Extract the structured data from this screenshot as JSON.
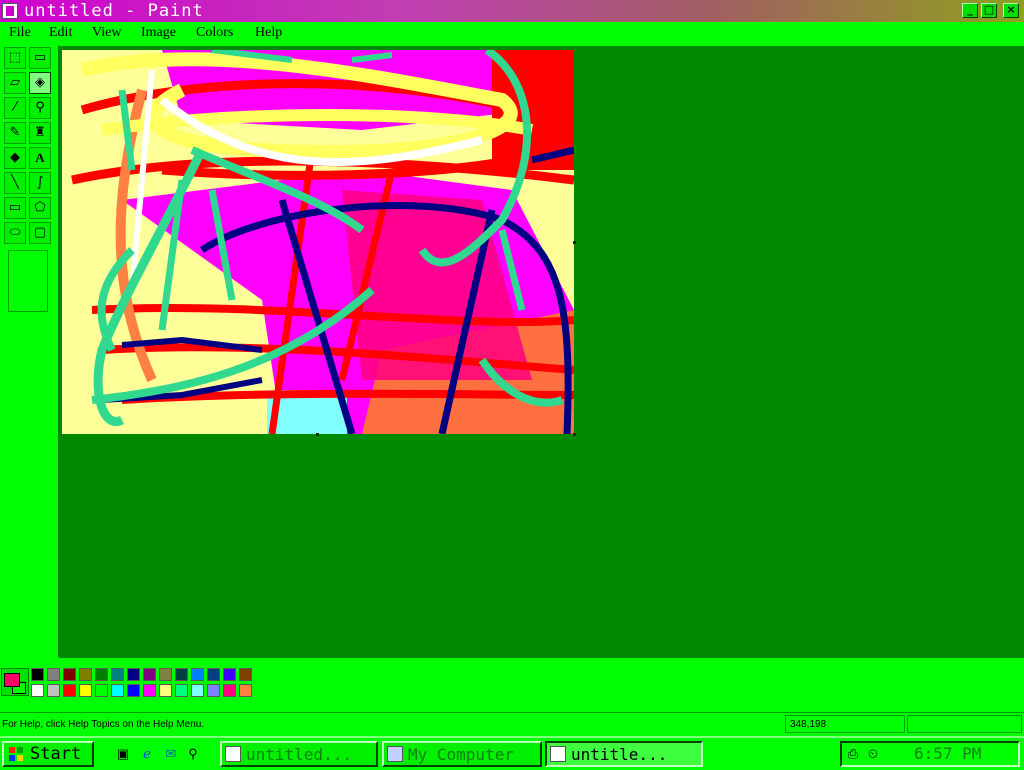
{
  "window": {
    "title": "untitled - Paint",
    "controls": [
      "_",
      "□",
      "×"
    ]
  },
  "menu": [
    "File",
    "Edit",
    "View",
    "Image",
    "Colors",
    "Help"
  ],
  "tools": [
    {
      "name": "free-form-select",
      "glyph": "⬚"
    },
    {
      "name": "select",
      "glyph": "▭"
    },
    {
      "name": "eraser",
      "glyph": "▱"
    },
    {
      "name": "fill-with-color",
      "glyph": "◈"
    },
    {
      "name": "pick-color",
      "glyph": "⁄"
    },
    {
      "name": "magnifier",
      "glyph": "⚲"
    },
    {
      "name": "pencil",
      "glyph": "✎"
    },
    {
      "name": "brush",
      "glyph": "♜"
    },
    {
      "name": "airbrush",
      "glyph": "◆"
    },
    {
      "name": "text",
      "glyph": "A"
    },
    {
      "name": "line",
      "glyph": "╲"
    },
    {
      "name": "curve",
      "glyph": "∫"
    },
    {
      "name": "rectangle",
      "glyph": "▭"
    },
    {
      "name": "polygon",
      "glyph": "⬠"
    },
    {
      "name": "ellipse",
      "glyph": "⬭"
    },
    {
      "name": "rounded-rectangle",
      "glyph": "▢"
    }
  ],
  "active_tool": "fill-with-color",
  "colors": {
    "foreground": "#ff0066",
    "background": "#00ff00",
    "palette_row1": [
      "#000000",
      "#808080",
      "#800000",
      "#808000",
      "#008000",
      "#008080",
      "#000080",
      "#800080",
      "#808040",
      "#004040",
      "#0080ff",
      "#004080",
      "#4000ff",
      "#804000"
    ],
    "palette_row2": [
      "#ffffff",
      "#c0c0c0",
      "#ff0000",
      "#ffff00",
      "#00ff00",
      "#00ffff",
      "#0000ff",
      "#ff00ff",
      "#ffff80",
      "#00ff80",
      "#80ffff",
      "#8080ff",
      "#ff0080",
      "#ff8040"
    ]
  },
  "status": {
    "help": "For Help, click Help Topics on the Help Menu.",
    "coords": "348,198"
  },
  "taskbar": {
    "start": "Start",
    "quick_launch": [
      "desktop-icon",
      "internet-explorer-icon",
      "outlook-express-icon",
      "channels-icon"
    ],
    "tasks": [
      {
        "label": "untitled...",
        "active": false
      },
      {
        "label": "My Computer",
        "active": false
      },
      {
        "label": "untitle...",
        "active": true
      }
    ],
    "clock": "6:57 PM"
  }
}
